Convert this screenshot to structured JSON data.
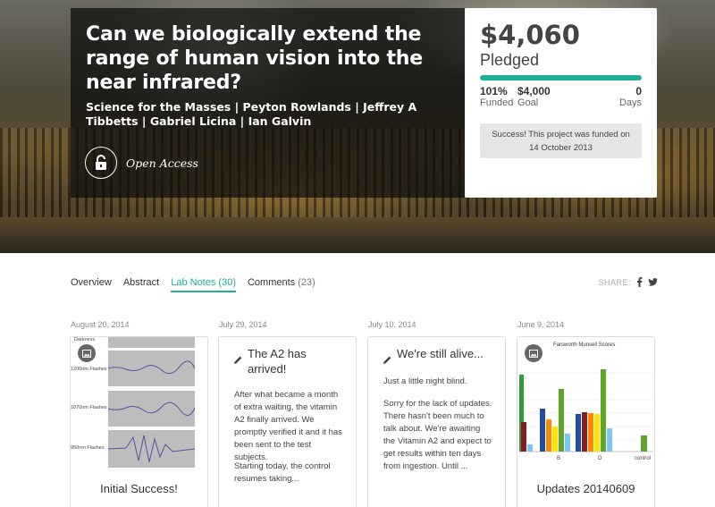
{
  "project": {
    "title": "Can we biologically extend the range of human vision into the near infrared?",
    "authors": "Science for the Masses | Peyton Rowlands | Jeffrey A Tibbetts | Gabriel Licina | Ian Galvin",
    "open_access_label": "Open Access"
  },
  "funding": {
    "amount": "$4,060",
    "pledged_label": "Pledged",
    "progress_fraction": 1.0,
    "funded_value": "101%",
    "funded_label": "Funded",
    "goal_value": "$4,000",
    "goal_label": "Goal",
    "days_value": "0",
    "days_label": "Days",
    "success_message": "Success! This project was funded on 14 October 2013",
    "accent_color": "#1fae9a"
  },
  "tabs": [
    {
      "label": "Overview",
      "count": ""
    },
    {
      "label": "Abstract",
      "count": ""
    },
    {
      "label": "Lab Notes",
      "count": "(30)"
    },
    {
      "label": "Comments",
      "count": "(23)"
    }
  ],
  "active_tab": "Lab Notes",
  "share": {
    "label": "SHARE:",
    "icons": [
      "facebook-icon",
      "twitter-icon"
    ]
  },
  "cards": [
    {
      "date": "August 20, 2014",
      "title": "Initial Success!",
      "image_labels": [
        "Darkness",
        "1200nm Flashes",
        "1070nm Flashes",
        "950nm Flashes"
      ]
    },
    {
      "date": "July 29, 2014",
      "title": "The A2 has arrived!",
      "body": "After what became a month of extra waiting, the vitamin A2 finally arrived. We promptly verified it and it has been sent to the test subjects.",
      "body2": "Starting today, the control resumes taking..."
    },
    {
      "date": "July 10, 2014",
      "title": "We're still alive...",
      "body": "Just a little night blind.",
      "body2": "Sorry for the lack of updates. There hasn't been much to talk about. We're awaiting the Vitamin A2 and expect to get results within ten days from ingestion. Until ..."
    },
    {
      "date": "June 9, 2014",
      "title": "Updates 20140609",
      "chart_title": "Farsworth Munsell Scores",
      "chart_categories": [
        "B",
        "D",
        "control"
      ]
    }
  ]
}
